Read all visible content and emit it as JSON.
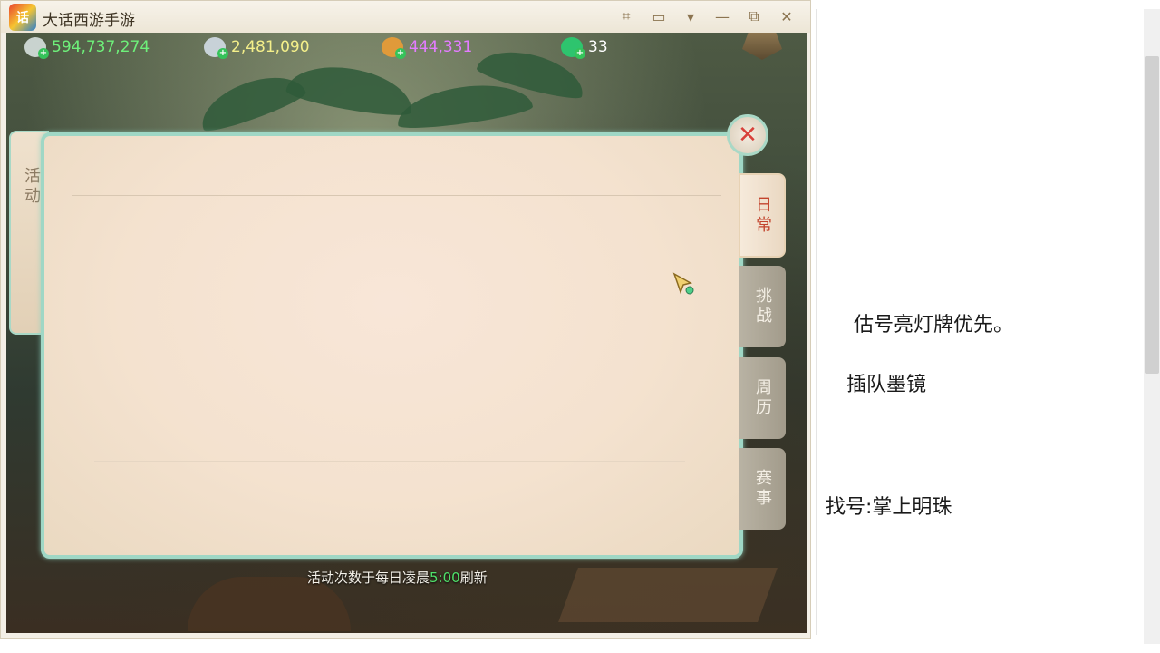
{
  "window": {
    "title": "大话西游手游",
    "icon_label": "话"
  },
  "titlebar_buttons": [
    {
      "name": "crop-icon",
      "glyph": "⌗"
    },
    {
      "name": "chat-icon",
      "glyph": "▭"
    },
    {
      "name": "dropdown-icon",
      "glyph": "▾"
    },
    {
      "name": "minimize-icon",
      "glyph": "—"
    },
    {
      "name": "restore-icon",
      "glyph": "⧉"
    },
    {
      "name": "close-icon",
      "glyph": "✕"
    }
  ],
  "currencies": [
    {
      "name": "xianyu",
      "value": "594,737,274",
      "color": "#6ef07a",
      "icon_color": "#c9d3cf"
    },
    {
      "name": "silver",
      "value": "2,481,090",
      "color": "#f4ef8a",
      "icon_color": "#c8d2d8"
    },
    {
      "name": "copper",
      "value": "444,331",
      "color": "#e37cff",
      "icon_color": "#e09a3a"
    },
    {
      "name": "jade",
      "value": "33",
      "color": "#ffffff",
      "icon_color": "#2ec46e"
    }
  ],
  "panel": {
    "left_tab_label": "活动",
    "close_glyph": "✕",
    "side_tabs": [
      {
        "label": "日常",
        "active": true
      },
      {
        "label": "挑战",
        "active": false
      },
      {
        "label": "周历",
        "active": false
      },
      {
        "label": "赛事",
        "active": false
      }
    ]
  },
  "footer": {
    "prefix": "活动次数于每日凌晨",
    "time": "5:00",
    "suffix": "刷新"
  },
  "notes": {
    "line1": "估号亮灯牌优先。",
    "line2": "插队墨镜",
    "line3": "找号:掌上明珠"
  }
}
